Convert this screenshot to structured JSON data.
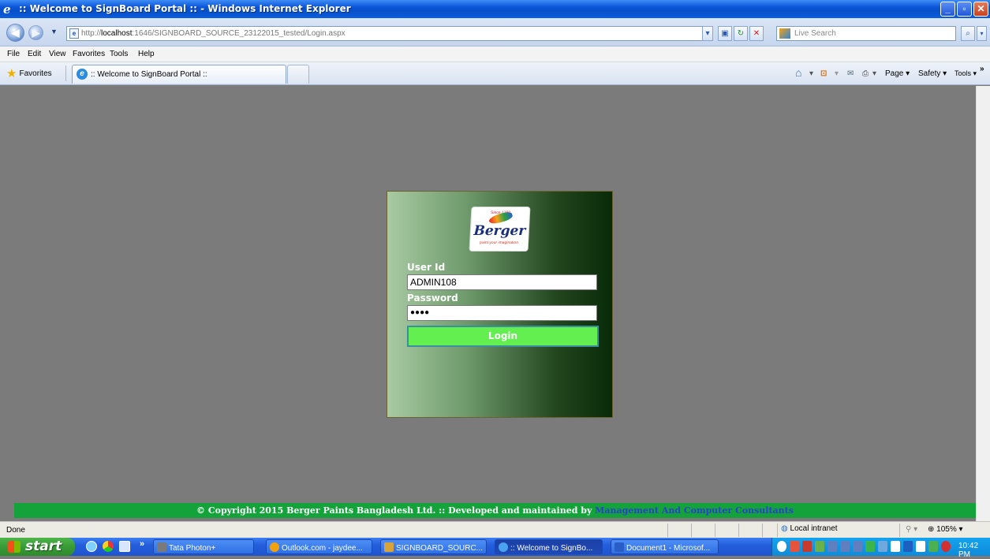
{
  "window": {
    "title": ":: Welcome to SignBoard Portal :: - Windows Internet Explorer",
    "minimize": "_",
    "maximize": "▫",
    "close": "✕"
  },
  "address": {
    "url_prefix": "http://",
    "url_host": "localhost",
    "url_rest": ":1646/SIGNBOARD_SOURCE_23122015_tested/Login.aspx",
    "search_placeholder": "Live Search"
  },
  "menu": [
    "File",
    "Edit",
    "View",
    "Favorites",
    "Tools",
    "Help"
  ],
  "favorites": {
    "label": "Favorites",
    "tab_title": ":: Welcome to SignBoard Portal ::"
  },
  "commandbar": {
    "page": "Page ▾",
    "safety": "Safety ▾",
    "tools": "Tools ▾"
  },
  "login": {
    "logo_brand": "Berger",
    "logo_since": "Since 1760",
    "logo_tagline": "paint your imagination",
    "user_label": "User Id",
    "user_value": "ADMIN108",
    "password_label": "Password",
    "password_value": "●●●●",
    "button": "Login"
  },
  "footer": {
    "text": "© Copyright 2015 Berger Paints Bangladesh Ltd. :: Developed and maintained by ",
    "link": "Management And Computer Consultants"
  },
  "status": {
    "text": "Done",
    "zone": "Local intranet",
    "zoom": "105%"
  },
  "taskbar": {
    "start": "start",
    "buttons": [
      {
        "label": "Tata Photon+",
        "color": "#7a7a7a"
      },
      {
        "label": "Outlook.com - jaydee...",
        "color": "#f2a20e"
      },
      {
        "label": "SIGNBOARD_SOURC...",
        "color": "#d8a33a"
      },
      {
        "label": ":: Welcome to SignBo...",
        "color": "#4aa3ef"
      },
      {
        "label": "Document1 - Microsof...",
        "color": "#2b5dc6"
      }
    ],
    "clock": "10:42 PM"
  },
  "colors": {
    "footer_bg": "#14a23a",
    "login_button": "#62ef4f",
    "page_bg": "#7b7b7b"
  }
}
